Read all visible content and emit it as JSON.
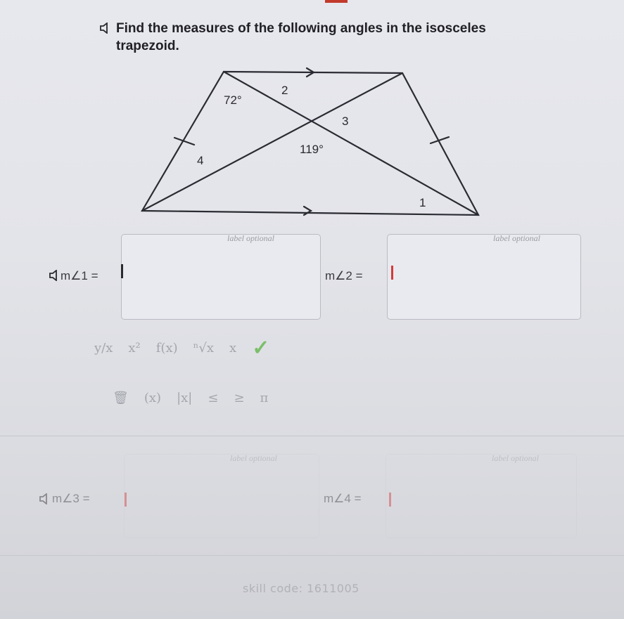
{
  "question": {
    "text": "Find the measures of the following angles in the isosceles trapezoid."
  },
  "figure": {
    "labels": {
      "angle_top_left": "72°",
      "angle_2": "2",
      "angle_3": "3",
      "angle_center": "119°",
      "angle_4": "4",
      "angle_1": "1"
    }
  },
  "answers": [
    {
      "label": "m∠1 =",
      "box_label": "label optional",
      "value": ""
    },
    {
      "label": "m∠2 =",
      "box_label": "label optional",
      "value": ""
    },
    {
      "label": "m∠3 =",
      "box_label": "label optional",
      "value": ""
    },
    {
      "label": "m∠4 =",
      "box_label": "label optional",
      "value": ""
    }
  ],
  "toolbar": {
    "row1": [
      "y/x",
      "x²",
      "f(x)",
      "ⁿ√x",
      "x",
      "✓"
    ],
    "row2": [
      "🗑",
      "(x)",
      "|x|",
      "≤",
      "≥",
      "π"
    ]
  },
  "footer": {
    "skill_code": "skill code: 1611005"
  },
  "colors": {
    "cursor_1": "#2a2a2e",
    "cursor_2": "#d43a3a",
    "check": "#7bbf6a",
    "tick": "#2a2a2e"
  }
}
